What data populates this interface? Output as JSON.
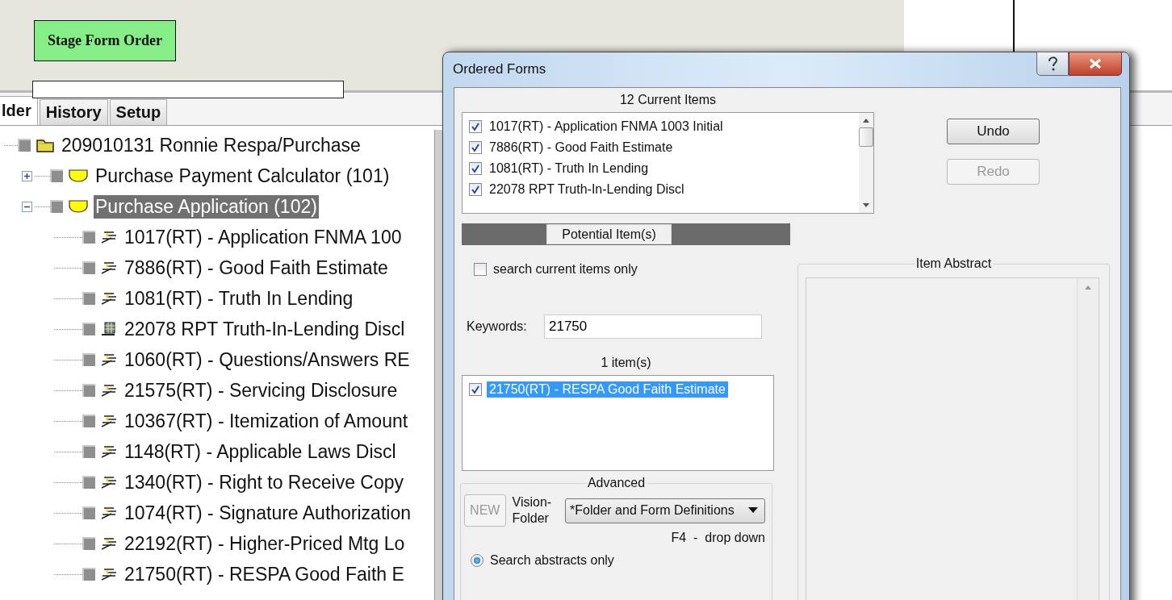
{
  "stage_button": "Stage Form Order",
  "tabs": [
    {
      "label": "lder",
      "selected": true
    },
    {
      "label": "History",
      "selected": false
    },
    {
      "label": "Setup",
      "selected": false
    }
  ],
  "tree": [
    {
      "label": "209010131 Ronnie Respa/Purchase",
      "kind": "folder",
      "checked": false,
      "selected": false,
      "children": [
        {
          "label": "Purchase Payment Calculator (101)",
          "kind": "group",
          "checked": false,
          "expanded": false,
          "selected": false
        },
        {
          "label": "Purchase Application (102)",
          "kind": "group",
          "checked": false,
          "expanded": true,
          "selected": true,
          "children": [
            {
              "label": "1017(RT) - Application FNMA 100",
              "kind": "form",
              "checked": false,
              "selected": false
            },
            {
              "label": "7886(RT) - Good Faith Estimate",
              "kind": "form",
              "checked": false,
              "selected": false
            },
            {
              "label": "1081(RT) - Truth In Lending",
              "kind": "form",
              "checked": false,
              "selected": false
            },
            {
              "label": "22078 RPT Truth-In-Lending Discl",
              "kind": "report",
              "checked": false,
              "selected": false
            },
            {
              "label": "1060(RT) - Questions/Answers RE",
              "kind": "form",
              "checked": false,
              "selected": false
            },
            {
              "label": "21575(RT) - Servicing Disclosure",
              "kind": "form",
              "checked": false,
              "selected": false
            },
            {
              "label": "10367(RT) - Itemization of Amount",
              "kind": "form",
              "checked": false,
              "selected": false
            },
            {
              "label": "1148(RT) - Applicable Laws Discl",
              "kind": "form",
              "checked": false,
              "selected": false
            },
            {
              "label": "1340(RT) - Right to Receive Copy",
              "kind": "form",
              "checked": false,
              "selected": false
            },
            {
              "label": "1074(RT) - Signature Authorization",
              "kind": "form",
              "checked": false,
              "selected": false
            },
            {
              "label": "22192(RT) - Higher-Priced Mtg Lo",
              "kind": "form",
              "checked": false,
              "selected": false
            },
            {
              "label": "21750(RT) - RESPA Good Faith E",
              "kind": "form",
              "checked": false,
              "selected": false
            }
          ]
        }
      ]
    }
  ],
  "dialog": {
    "title": "Ordered Forms",
    "current_items": {
      "heading": "12 Current Items",
      "items": [
        {
          "label": "1017(RT) - Application FNMA 1003 Initial",
          "checked": true
        },
        {
          "label": "7886(RT) - Good Faith Estimate",
          "checked": true
        },
        {
          "label": "1081(RT) - Truth In Lending",
          "checked": true
        },
        {
          "label": "22078 RPT Truth-In-Lending Discl",
          "checked": true
        }
      ]
    },
    "undo": {
      "label": "Undo",
      "disabled": false
    },
    "redo": {
      "label": "Redo",
      "disabled": true
    },
    "potential_tab": "Potential Item(s)",
    "search_current": {
      "label": "search current items only",
      "checked": false
    },
    "keywords": {
      "label": "Keywords:",
      "value": "21750"
    },
    "results": {
      "heading": "1 item(s)",
      "items": [
        {
          "label": "21750(RT) - RESPA Good Faith Estimate",
          "checked": true,
          "selected": true
        }
      ]
    },
    "advanced": {
      "title": "Advanced",
      "new_button": {
        "label": "NEW",
        "disabled": true
      },
      "folder_label": "Vision-\nFolder",
      "folder_value": "*Folder and Form Definitions",
      "hint": "F4  -  drop down",
      "radio": {
        "label": "Search abstracts only",
        "selected": true
      }
    },
    "abstract": {
      "title": "Item Abstract"
    }
  }
}
